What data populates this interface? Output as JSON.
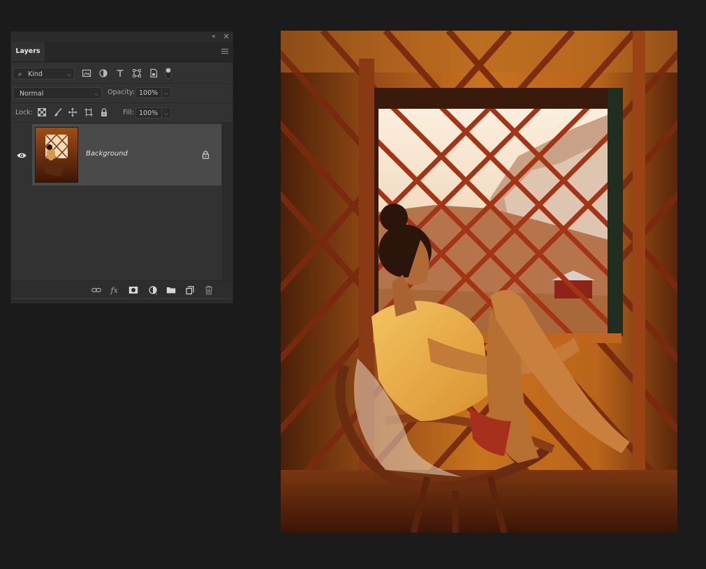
{
  "layers_panel": {
    "tab_label": "Layers",
    "topbar": {
      "collapse_glyph": "«",
      "close_glyph": "✕"
    },
    "filter": {
      "kind_label": "Kind",
      "icons": [
        "image-filter-icon",
        "adjustment-filter-icon",
        "type-filter-icon",
        "shape-filter-icon",
        "smart-object-filter-icon",
        "filter-toggle-icon"
      ]
    },
    "blend": {
      "mode": "Normal",
      "opacity_label": "Opacity:",
      "opacity_value": "100%"
    },
    "lock": {
      "lock_label": "Lock:",
      "fill_label": "Fill:",
      "fill_value": "100%",
      "icons": [
        "lock-transparent-pixels-icon",
        "lock-image-pixels-icon",
        "lock-position-icon",
        "lock-artboard-icon",
        "lock-all-icon"
      ]
    },
    "layers": [
      {
        "name": "Background",
        "visible": true,
        "locked": true
      }
    ],
    "bottom_icons": [
      "link-layers-icon",
      "fx-icon",
      "layer-mask-icon",
      "adjustment-layer-icon",
      "group-folder-icon",
      "new-layer-icon",
      "trash-icon"
    ]
  },
  "document": {
    "subject": "photo"
  },
  "colors": {
    "workspace_bg": "#1b1b1b",
    "panel_bg": "#323232",
    "selected_layer_bg": "#4a4a4a"
  }
}
